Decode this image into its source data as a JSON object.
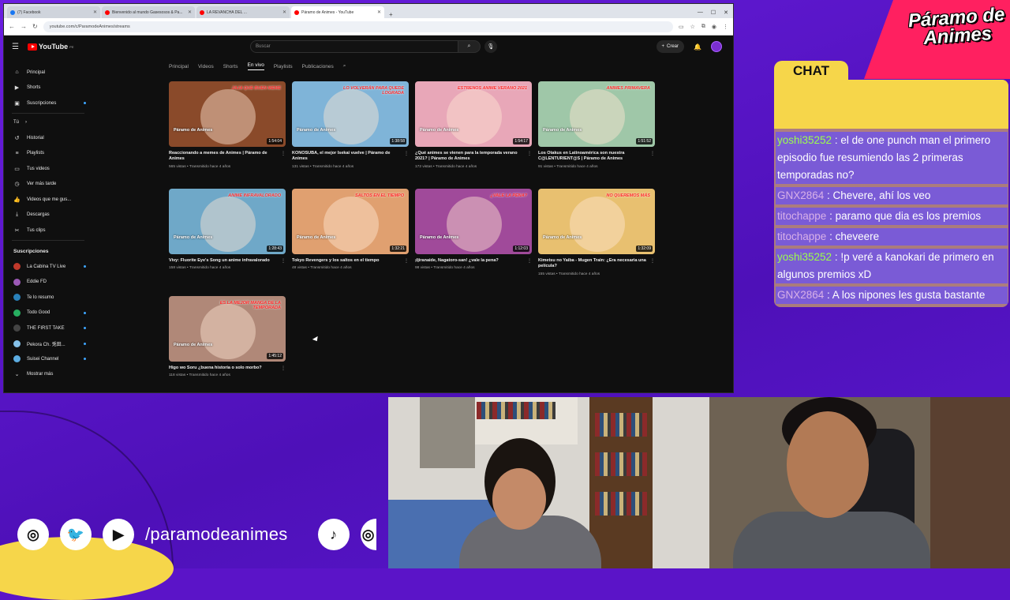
{
  "browser": {
    "tabs": [
      {
        "label": "(7) Facebook",
        "active": false
      },
      {
        "label": "Bienvenido al mundo Gasesosos & Pa...",
        "active": false
      },
      {
        "label": "LA REVANCHA DEL ...",
        "active": false
      },
      {
        "label": "Páramo de Animes - YouTube",
        "active": true
      }
    ],
    "url": "youtube.com/c/ParamodeAnimes/streams"
  },
  "youtube": {
    "search_placeholder": "Buscar",
    "create_label": "Crear",
    "sidebar": {
      "main": [
        {
          "label": "Principal",
          "icon": "home-icon"
        },
        {
          "label": "Shorts",
          "icon": "shorts-icon"
        },
        {
          "label": "Suscripciones",
          "icon": "subscriptions-icon"
        }
      ],
      "you_header": "Tú",
      "you": [
        {
          "label": "Historial",
          "icon": "history-icon"
        },
        {
          "label": "Playlists",
          "icon": "playlist-icon"
        },
        {
          "label": "Tus videos",
          "icon": "video-icon"
        },
        {
          "label": "Ver más tarde",
          "icon": "clock-icon"
        },
        {
          "label": "Videos que me gus...",
          "icon": "like-icon"
        },
        {
          "label": "Descargas",
          "icon": "download-icon"
        },
        {
          "label": "Tus clips",
          "icon": "scissors-icon"
        }
      ],
      "subs_header": "Suscripciones",
      "subs": [
        {
          "label": "La Cabina TV Live",
          "color": "#c0392b"
        },
        {
          "label": "Eddie FD",
          "color": "#9b59b6"
        },
        {
          "label": "Te lo resumo",
          "color": "#2980b9"
        },
        {
          "label": "Todo Good",
          "color": "#27ae60"
        },
        {
          "label": "THE FIRST TAKE",
          "color": "#444444"
        },
        {
          "label": "Pekora Ch. 兎田...",
          "color": "#85c1e9"
        },
        {
          "label": "Suisei Channel",
          "color": "#5dade2"
        }
      ],
      "show_more": "Mostrar más"
    },
    "channel_tabs": [
      "Principal",
      "Videos",
      "Shorts",
      "En vivo",
      "Playlists",
      "Publicaciones"
    ],
    "active_tab": "En vivo",
    "videos": [
      {
        "title": "Reaccionando a memes de Animes | Páramo de Animes",
        "stats": "565 vistas • Transmitido hace 4 años",
        "duration": "1:54:04",
        "banner": "JAJA QUE BUEN MEME",
        "bg": "#8a4a2a"
      },
      {
        "title": "KONOSUBA, el mejor Isekai vuelve | Páramo de Animes",
        "stats": "131 vistas • Transmitido hace 4 años",
        "duration": "1:38:58",
        "banner": "LO VOLVERÁN PARA QUEDE LOGRADA",
        "bg": "#7fb4d8"
      },
      {
        "title": "¿Qué animes se vienen para la temporada verano 2021? | Páramo de Animes",
        "stats": "172 vistas • Transmitido hace 4 años",
        "duration": "1:54:17",
        "banner": "ESTRENOS ANIME VERANO 2021",
        "bg": "#e8a7b8"
      },
      {
        "title": "Los Otakus en Latinoamérica son nuestra C@LENTURIENT@S | Páramo de Animes",
        "stats": "91 vistas • Transmitido hace 4 años",
        "duration": "1:51:52",
        "banner": "ANIMES PRIMAVERA",
        "bg": "#9fc7a8"
      },
      {
        "title": "Vivy: Fluorite Eye's Song un anime infravalorado",
        "stats": "158 vistas • Transmitido hace 4 años",
        "duration": "1:28:43",
        "banner": "ANIME INFRAVALORADO",
        "bg": "#6fa8c8"
      },
      {
        "title": "Tokyo Revengers y los saltos en el tiempo",
        "stats": "48 vistas • Transmitido hace 4 años",
        "duration": "1:32:21",
        "banner": "SALTOS EN EL TIEMPO",
        "bg": "#e0a070"
      },
      {
        "title": "¡Ijiranaide, Nagatoro-san! ¿vale la pena?",
        "stats": "98 vistas • Transmitido hace 4 años",
        "duration": "1:12:03",
        "banner": "¿VALE LA PENA?",
        "bg": "#a04a9a"
      },
      {
        "title": "Kimetsu no Yaiba - Mugen Train: ¿Era necesaria una película?",
        "stats": "155 vistas • Transmitido hace 4 años",
        "duration": "1:32:09",
        "banner": "NO QUEREMOS MÁS",
        "bg": "#e8c070"
      },
      {
        "title": "Higo wo Soru ¿buena historia o solo morbo?",
        "stats": "118 vistas • Transmitido hace 4 años",
        "duration": "1:45:12",
        "banner": "ES LA MEJOR MANGA DE LA TEMPORADA",
        "bg": "#b08878"
      }
    ],
    "thumb_label": "Páramo de Animes"
  },
  "overlay": {
    "brand": "Páramo de Animes",
    "chat_title": "CHAT",
    "chat": [
      {
        "user": "yoshi35252",
        "text": " : el de one punch man el primero episodio fue resumiendo las 2 primeras temporadas no?",
        "color": "green"
      },
      {
        "user": "GNX2864",
        "text": " : Chevere, ahí los veo",
        "color": "pink"
      },
      {
        "user": "titochappe",
        "text": " : paramo que dia es los premios",
        "color": "pink"
      },
      {
        "user": "titochappe",
        "text": " : cheveere",
        "color": "pink"
      },
      {
        "user": "yoshi35252",
        "text": " : !p veré a kanokari de primero en algunos premios xD",
        "color": "green"
      },
      {
        "user": "GNX2864",
        "text": " : A los nipones les gusta bastante",
        "color": "pink"
      }
    ],
    "handle": "/paramodeanimes",
    "socials": [
      "instagram-icon",
      "twitter-icon",
      "youtube-icon",
      "tiktok-icon"
    ]
  }
}
